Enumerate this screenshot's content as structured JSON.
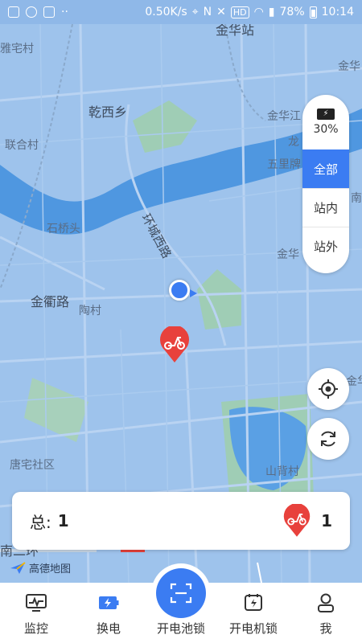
{
  "status_bar": {
    "speed": "0.50K/s",
    "hd": "HD",
    "battery": "78%",
    "time": "10:14"
  },
  "map": {
    "labels": {
      "jinhua_station": "金华站",
      "zhai_cun": "雅宅村",
      "qianxi_xiang": "乾西乡",
      "lianhe_cun": "联合村",
      "jinhua_jiang": "金华江",
      "long": "龙",
      "wulipai": "五里牌",
      "shiqiaotou": "石桥头",
      "huancheng_xilu": "环城西路",
      "jinhua_mid": "金华",
      "jinqu_lu": "金衢路",
      "tao_cun": "陶村",
      "tangzhai_shequ": "唐宅社区",
      "shanbei_cun": "山背村",
      "jinhua_top_right": "金华",
      "nan_jie": "南街",
      "jin_right": "金华",
      "nan_erhuan": "南二环"
    },
    "logo_text": "高德地图"
  },
  "filter": {
    "battery_pct": "30%",
    "options": [
      "全部",
      "站内",
      "站外"
    ],
    "active_index": 0
  },
  "summary": {
    "total_label": "总:",
    "total_count": "1",
    "scooter_count": "1"
  },
  "tabs": [
    {
      "label": "监控",
      "icon": "monitor-icon"
    },
    {
      "label": "换电",
      "icon": "battery-swap-icon"
    },
    {
      "label": "开电池锁",
      "icon": "scan-icon"
    },
    {
      "label": "开电机锁",
      "icon": "motor-lock-icon"
    },
    {
      "label": "我",
      "icon": "user-icon"
    }
  ],
  "colors": {
    "accent": "#3b7cf2",
    "map_water": "#4f97e0",
    "map_land": "#9ec3ec",
    "marker_red": "#e8413c"
  }
}
